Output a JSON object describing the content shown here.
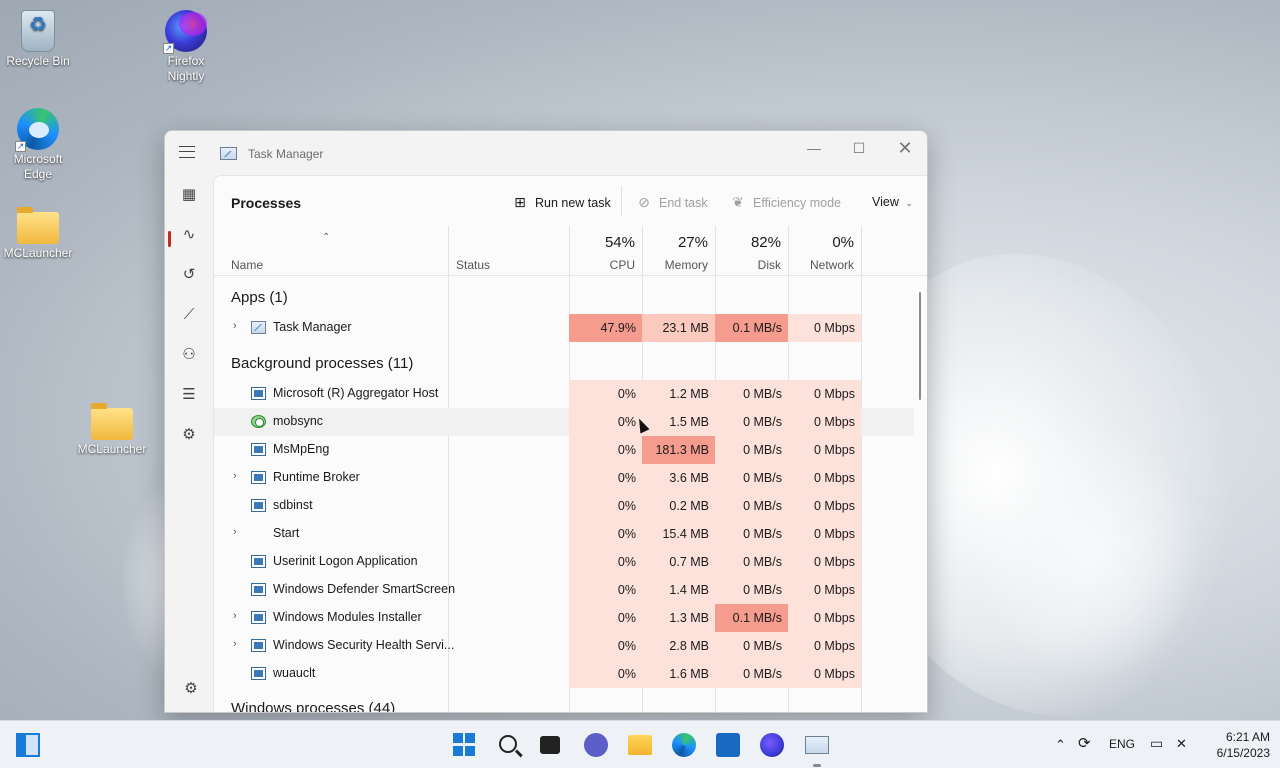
{
  "desktop": {
    "icons": [
      {
        "label": "Recycle Bin"
      },
      {
        "label": "Firefox Nightly"
      },
      {
        "label": "Microsoft Edge"
      },
      {
        "label": "MCLauncher"
      },
      {
        "label": "MCLauncher"
      }
    ]
  },
  "window": {
    "title": "Task Manager",
    "controls": {
      "minimize": "—",
      "maximize": "☐",
      "close": "✕"
    }
  },
  "toolbar": {
    "page_title": "Processes",
    "run_new_task": "Run new task",
    "end_task": "End task",
    "efficiency_mode": "Efficiency mode",
    "view": "View"
  },
  "columns": {
    "name": "Name",
    "status": "Status",
    "cpu": {
      "percent": "54%",
      "label": "CPU"
    },
    "memory": {
      "percent": "27%",
      "label": "Memory"
    },
    "disk": {
      "percent": "82%",
      "label": "Disk"
    },
    "network": {
      "percent": "0%",
      "label": "Network"
    }
  },
  "groups": {
    "apps": "Apps (1)",
    "background": "Background processes (11)",
    "windows": "Windows processes (44)"
  },
  "apps": [
    {
      "name": "Task Manager",
      "cpu": "47.9%",
      "memory": "23.1 MB",
      "disk": "0.1 MB/s",
      "network": "0 Mbps"
    }
  ],
  "background": [
    {
      "name": "Microsoft (R) Aggregator Host",
      "cpu": "0%",
      "memory": "1.2 MB",
      "disk": "0 MB/s",
      "network": "0 Mbps"
    },
    {
      "name": "mobsync",
      "cpu": "0%",
      "memory": "1.5 MB",
      "disk": "0 MB/s",
      "network": "0 Mbps"
    },
    {
      "name": "MsMpEng",
      "cpu": "0%",
      "memory": "181.3 MB",
      "disk": "0 MB/s",
      "network": "0 Mbps"
    },
    {
      "name": "Runtime Broker",
      "cpu": "0%",
      "memory": "3.6 MB",
      "disk": "0 MB/s",
      "network": "0 Mbps"
    },
    {
      "name": "sdbinst",
      "cpu": "0%",
      "memory": "0.2 MB",
      "disk": "0 MB/s",
      "network": "0 Mbps"
    },
    {
      "name": "Start",
      "cpu": "0%",
      "memory": "15.4 MB",
      "disk": "0 MB/s",
      "network": "0 Mbps"
    },
    {
      "name": "Userinit Logon Application",
      "cpu": "0%",
      "memory": "0.7 MB",
      "disk": "0 MB/s",
      "network": "0 Mbps"
    },
    {
      "name": "Windows Defender SmartScreen",
      "cpu": "0%",
      "memory": "1.4 MB",
      "disk": "0 MB/s",
      "network": "0 Mbps"
    },
    {
      "name": "Windows Modules Installer",
      "cpu": "0%",
      "memory": "1.3 MB",
      "disk": "0.1 MB/s",
      "network": "0 Mbps"
    },
    {
      "name": "Windows Security Health Servi...",
      "cpu": "0%",
      "memory": "2.8 MB",
      "disk": "0 MB/s",
      "network": "0 Mbps"
    },
    {
      "name": "wuauclt",
      "cpu": "0%",
      "memory": "1.6 MB",
      "disk": "0 MB/s",
      "network": "0 Mbps"
    }
  ],
  "taskbar": {
    "language": "ENG",
    "time": "6:21 AM",
    "date": "6/15/2023"
  },
  "colors": {
    "accent": "#1a7ad8",
    "heat_low": "#fde2dc",
    "heat_mid": "#fbc9bd",
    "heat_high": "#f69c8f",
    "nav_indicator": "#c42b1c"
  }
}
